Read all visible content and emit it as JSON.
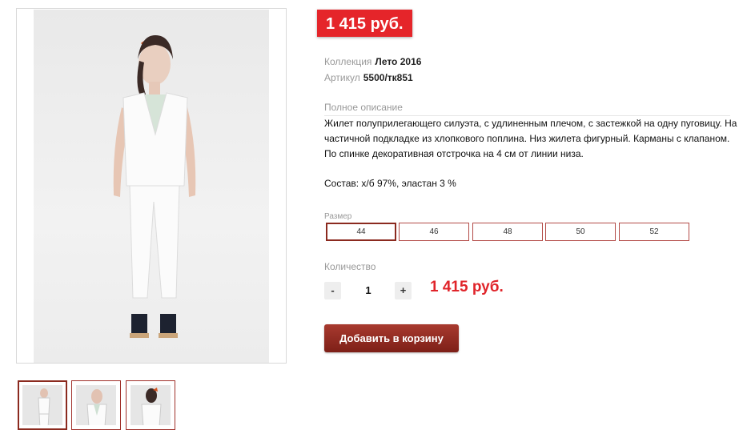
{
  "product": {
    "price_badge": "1 415 руб.",
    "collection_label": "Коллекция",
    "collection_value": "Лето 2016",
    "sku_label": "Артикул",
    "sku_value": "5500/тк851",
    "description_heading": "Полное описание",
    "description": "Жилет полуприлегающего силуэта, с удлиненным плечом, с застежкой на одну пуговицу. На частичной подкладке из хлопкового поплина. Низ жилета фигурный. Карманы с клапаном. По спинке декоративная отстрочка на 4 см от линии низа.",
    "composition": "Состав: х/б 97%, эластан 3 %"
  },
  "size": {
    "label": "Размер",
    "options": [
      "44",
      "46",
      "48",
      "50",
      "52"
    ],
    "selected": "44"
  },
  "quantity": {
    "label": "Количество",
    "minus": "-",
    "value": "1",
    "plus": "+",
    "total": "1 415 руб."
  },
  "cart": {
    "add_label": "Добавить в корзину"
  },
  "gallery": {
    "thumbnail_count": 3,
    "active_index": 0
  },
  "colors": {
    "price": "#e5252a",
    "accent_dark": "#8b2a1f",
    "size_border": "#b34b47"
  }
}
